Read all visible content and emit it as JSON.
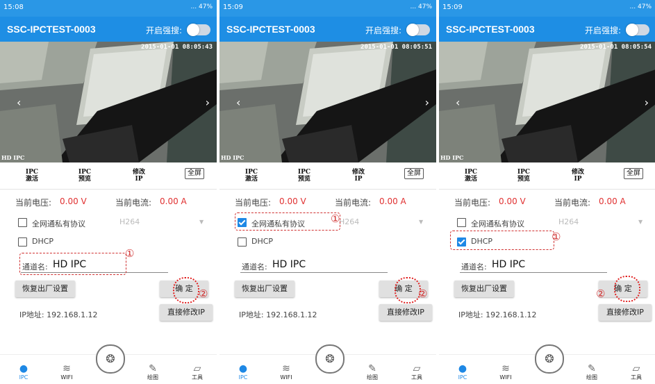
{
  "phones": [
    {
      "time": "15:08",
      "signal": "... 47%",
      "title": "SSC-IPCTEST-0003",
      "strong_search": "开启强搜:",
      "timestamp": "2015-01-01 08:05:43",
      "hd": "HD IPC",
      "toolbar": [
        "IPC 激活",
        "IPC 预览",
        "修改 IP",
        "全屏"
      ],
      "voltage_label": "当前电压:",
      "voltage_value": "0.00 V",
      "current_label": "当前电流:",
      "current_value": "0.00 A",
      "private_protocol": "全网通私有协议",
      "private_checked": false,
      "codec": "H264",
      "dhcp": "DHCP",
      "dhcp_checked": false,
      "channel_label": "通道名:",
      "channel_value": "HD IPC",
      "restore_button": "恢复出厂设置",
      "confirm_button": "确 定",
      "ip_label": "IP地址: 192.168.1.12",
      "modify_ip_button": "直接修改IP",
      "annot1": "①",
      "annot2": "②",
      "tabs": [
        "IPC",
        "WIFI",
        "绘图",
        "工具"
      ]
    },
    {
      "time": "15:09",
      "signal": "... 47%",
      "title": "SSC-IPCTEST-0003",
      "strong_search": "开启强搜:",
      "timestamp": "2015-01-01 08:05:51",
      "hd": "HD IPC",
      "toolbar": [
        "IPC 激活",
        "IPC 预览",
        "修改 IP",
        "全屏"
      ],
      "voltage_label": "当前电压:",
      "voltage_value": "0.00 V",
      "current_label": "当前电流:",
      "current_value": "0.00 A",
      "private_protocol": "全网通私有协议",
      "private_checked": true,
      "codec": "H264",
      "dhcp": "DHCP",
      "dhcp_checked": false,
      "channel_label": "通道名:",
      "channel_value": "HD IPC",
      "restore_button": "恢复出厂设置",
      "confirm_button": "确 定",
      "ip_label": "IP地址: 192.168.1.12",
      "modify_ip_button": "直接修改IP",
      "annot1": "①",
      "annot2": "②",
      "tabs": [
        "IPC",
        "WIFI",
        "绘图",
        "工具"
      ]
    },
    {
      "time": "15:09",
      "signal": "... 47%",
      "title": "SSC-IPCTEST-0003",
      "strong_search": "开启强搜:",
      "timestamp": "2015-01-01 08:05:54",
      "hd": "HD IPC",
      "toolbar": [
        "IPC 激活",
        "IPC 预览",
        "修改 IP",
        "全屏"
      ],
      "voltage_label": "当前电压:",
      "voltage_value": "0.00 V",
      "current_label": "当前电流:",
      "current_value": "0.00 A",
      "private_protocol": "全网通私有协议",
      "private_checked": false,
      "codec": "H264",
      "dhcp": "DHCP",
      "dhcp_checked": true,
      "channel_label": "通道名:",
      "channel_value": "HD IPC",
      "restore_button": "恢复出厂设置",
      "confirm_button": "确 定",
      "ip_label": "IP地址: 192.168.1.12",
      "modify_ip_button": "直接修改IP",
      "annot1": "①",
      "annot2": "②",
      "tabs": [
        "IPC",
        "WIFI",
        "绘图",
        "工具"
      ]
    }
  ],
  "colors": {
    "status": "#2a97e6",
    "titlebar": "#1e8ee4",
    "accent": "#1e88e5",
    "red": "#e03030"
  },
  "icons": {
    "tab_ipc": "camera-icon",
    "tab_wifi": "wifi-icon",
    "tab_draw": "pencil-icon",
    "tab_tools": "ruler-icon"
  }
}
